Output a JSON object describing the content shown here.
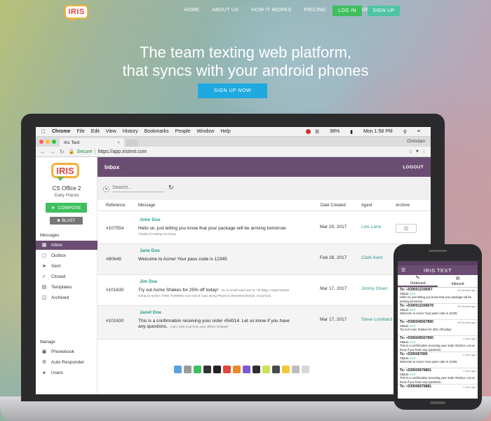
{
  "site": {
    "logo_text": "IRIS",
    "nav": [
      "HOME",
      "ABOUT US",
      "HOW IT WORKS",
      "PRICING",
      "DASHBOARD"
    ],
    "login_label": "LOG IN",
    "signup_label": "SIGN UP",
    "hero_line1": "The team texting web platform,",
    "hero_line2": "that syncs with your android phones",
    "cta_label": "SIGN UP NOW"
  },
  "macbar": {
    "items": [
      "Chrome",
      "File",
      "Edit",
      "View",
      "History",
      "Bookmarks",
      "People",
      "Window",
      "Help"
    ],
    "battery": "98%",
    "clock": "Mon 1:58 PM"
  },
  "browser": {
    "tab_title": "Iris Text",
    "user": "Christian",
    "secure_label": "Secure",
    "url": "https://app.iristext.com"
  },
  "app": {
    "logo_text": "IRIS",
    "office_name": "CS Office 2",
    "office_sub": "Daily Planet",
    "compose_label": "COMPOSE",
    "blast_label": "BLAST",
    "messages_heading": "Messages",
    "messages_items": [
      "Inbox",
      "Outbox",
      "Sent",
      "Closed",
      "Templates",
      "Archived"
    ],
    "manage_heading": "Manage",
    "manage_items": [
      "Phonebook",
      "Auto Responder",
      "Users"
    ],
    "page_title": "Inbox",
    "logout_label": "LOGOUT",
    "search_placeholder": "Search...",
    "columns": [
      "Reference",
      "Message",
      "Date Created",
      "Agent",
      "Archive"
    ],
    "rows": [
      {
        "ref": "#107554",
        "from": "John Doe",
        "message": "Hello sir, just letting you know that your package will be arriving tomorrow",
        "note": "- Thanks for letting me know",
        "date": "Mar 20, 2017",
        "agent": "Lois Lane"
      },
      {
        "ref": "#80648",
        "from": "Jane Doe",
        "message": "Welcome to Acme! Your pass code is 12345",
        "note": "",
        "date": "Feb 28, 2017",
        "agent": "Clark Kent"
      },
      {
        "ref": "#101630",
        "from": "Jim Doe",
        "message": "Try out Acme Shakes for 25% off today!",
        "note": "- Go to small road next to \"All Bldg A Supermarket entrance & BSA TWIN TOWERS is at end of road. Bring Phone & interested friends. Good luck.",
        "date": "Mar 17, 2017",
        "agent": "Jimmy Olsen"
      },
      {
        "ref": "#101630",
        "from": "Janet Doe",
        "message": "This is a confirmation receiving your order #54314. Let us know if you have any questions.",
        "note": "- Can I pick it up from your offices instead?",
        "date": "Mar 17, 2017",
        "agent": "Steve Lombard"
      }
    ]
  },
  "phone": {
    "title": "IRIS TEXT",
    "tab_outbound": "Outbound",
    "tab_inbound": "Inbound",
    "messages": [
      {
        "to": "To: +5390012345/67",
        "ago": "15 minutes ago",
        "status": "sent",
        "text": "Hello sir, just letting you know that your package will be arriving tomorrow"
      },
      {
        "to": "To: +5390012345678",
        "ago": "15 minutes ago",
        "status": "sent",
        "text": "Welcome to Acme! Your pass code is 12345"
      },
      {
        "to": "To: +5390045567890",
        "ago": "15 minutes ago",
        "status": "sent",
        "text": "Try out Acme Shakes for 25% off today!"
      },
      {
        "to": "To: +5390045567890",
        "ago": "1 hour ago",
        "status": "sent",
        "text": "This is a confirmation receiving your order #54314. Let us know if you have any questions."
      },
      {
        "to": "To: +5390067890",
        "ago": "1 hour ago",
        "status": "sent",
        "text": "Welcome to Acme! Your pass code is 12345"
      },
      {
        "to": "To: +539005678801",
        "ago": "1 hour ago",
        "status": "sent",
        "text": "This is a confirmation receiving your order #54314. Let us know if you have any questions."
      },
      {
        "to": "To: +539006578881",
        "ago": "1 hour ago",
        "status": "",
        "text": ""
      }
    ]
  },
  "colors": {
    "brand_purple": "#6b4c72",
    "green": "#3fbf5f",
    "teal": "#2a9b8b",
    "cta_blue": "#1fa9e0"
  }
}
